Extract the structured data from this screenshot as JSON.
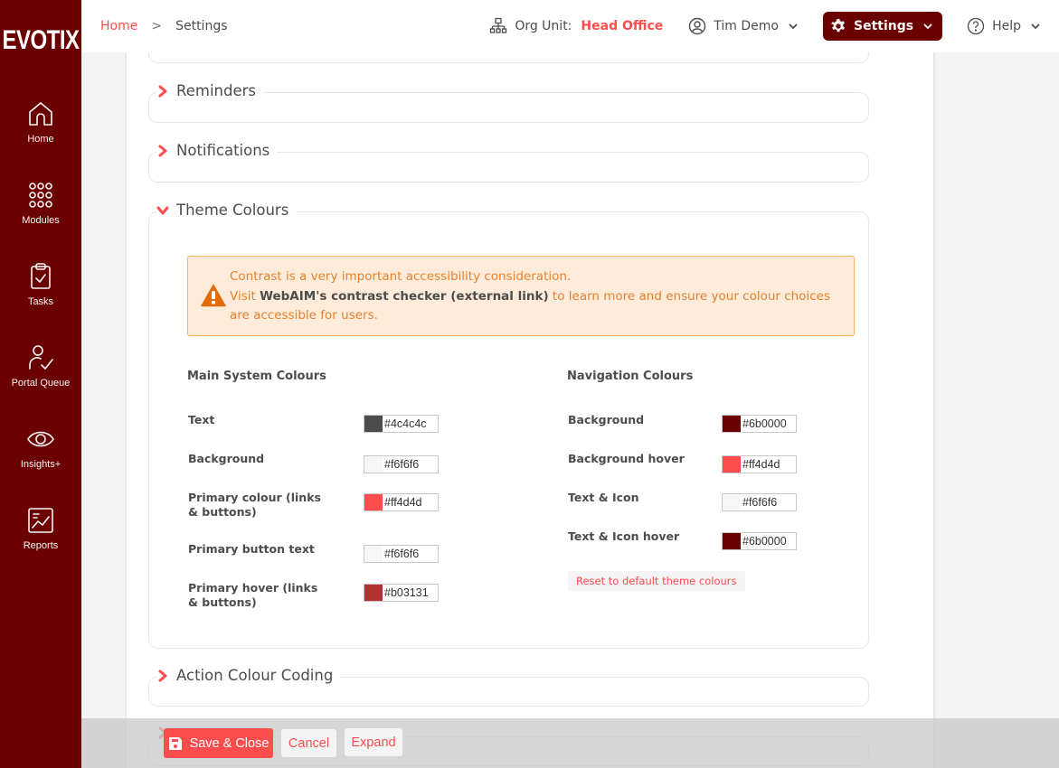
{
  "brand": {
    "logo_text": "EVOTIX"
  },
  "sidebar": {
    "items": [
      {
        "label": "Home",
        "icon": "home-icon"
      },
      {
        "label": "Modules",
        "icon": "grid-dots-icon"
      },
      {
        "label": "Tasks",
        "icon": "clipboard-check-icon"
      },
      {
        "label": "Portal Queue",
        "icon": "user-check-icon"
      },
      {
        "label": "Insights+",
        "icon": "eye-icon"
      },
      {
        "label": "Reports",
        "icon": "chart-report-icon"
      }
    ]
  },
  "header": {
    "breadcrumb": {
      "home": "Home",
      "separator": ">",
      "current": "Settings"
    },
    "org_unit_label": "Org Unit:",
    "org_unit_value": "Head Office",
    "user_name": "Tim Demo",
    "settings_label": "Settings",
    "help_label": "Help"
  },
  "sections": {
    "reminders": "Reminders",
    "notifications": "Notifications",
    "theme_colours": "Theme Colours",
    "action_colour_coding": "Action Colour Coding"
  },
  "alert": {
    "line1": "Contrast is a very important accessibility consideration.",
    "visit": "Visit ",
    "link": "WebAIM's contrast checker (external link)",
    "rest": " to learn more and ensure your colour choices are accessible for users."
  },
  "main_colours": {
    "title": "Main System Colours",
    "items": [
      {
        "label": "Text",
        "value": "#4c4c4c"
      },
      {
        "label": "Background",
        "value": "#f6f6f6"
      },
      {
        "label": "Primary colour (links & buttons)",
        "value": "#ff4d4d"
      },
      {
        "label": "Primary button text",
        "value": "#f6f6f6"
      },
      {
        "label": "Primary hover (links & buttons)",
        "value": "#b03131"
      }
    ]
  },
  "nav_colours": {
    "title": "Navigation Colours",
    "items": [
      {
        "label": "Background",
        "value": "#6b0000"
      },
      {
        "label": "Background hover",
        "value": "#ff4d4d"
      },
      {
        "label": "Text & Icon",
        "value": "#f6f6f6"
      },
      {
        "label": "Text & Icon hover",
        "value": "#6b0000"
      }
    ],
    "reset_label": "Reset to default theme colours"
  },
  "footer": {
    "save_label": "Save & Close",
    "cancel_label": "Cancel",
    "expand_label": "Expand"
  },
  "colors": {
    "nav_bg": "#6b0000",
    "primary": "#ff4d4d",
    "text": "#4c4c4c"
  }
}
